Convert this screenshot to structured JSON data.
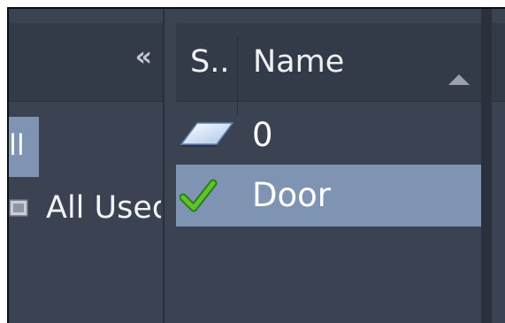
{
  "left_panel": {
    "collapse_label": "«",
    "selected_partial": "ll",
    "item_label": "All Used Layers"
  },
  "layer_list": {
    "columns": {
      "status": "S..",
      "name": "Name"
    },
    "sort": "ascending",
    "rows": [
      {
        "status_icon": "layer-parallelogram-icon",
        "name": "0"
      },
      {
        "status_icon": "green-checkmark-icon",
        "name": "Door",
        "selected": true
      }
    ]
  },
  "colors": {
    "panel_bg": "#3b4352",
    "header_bg": "#343b48",
    "selection": "#7f93b2",
    "check_green": "#4fa72a"
  }
}
